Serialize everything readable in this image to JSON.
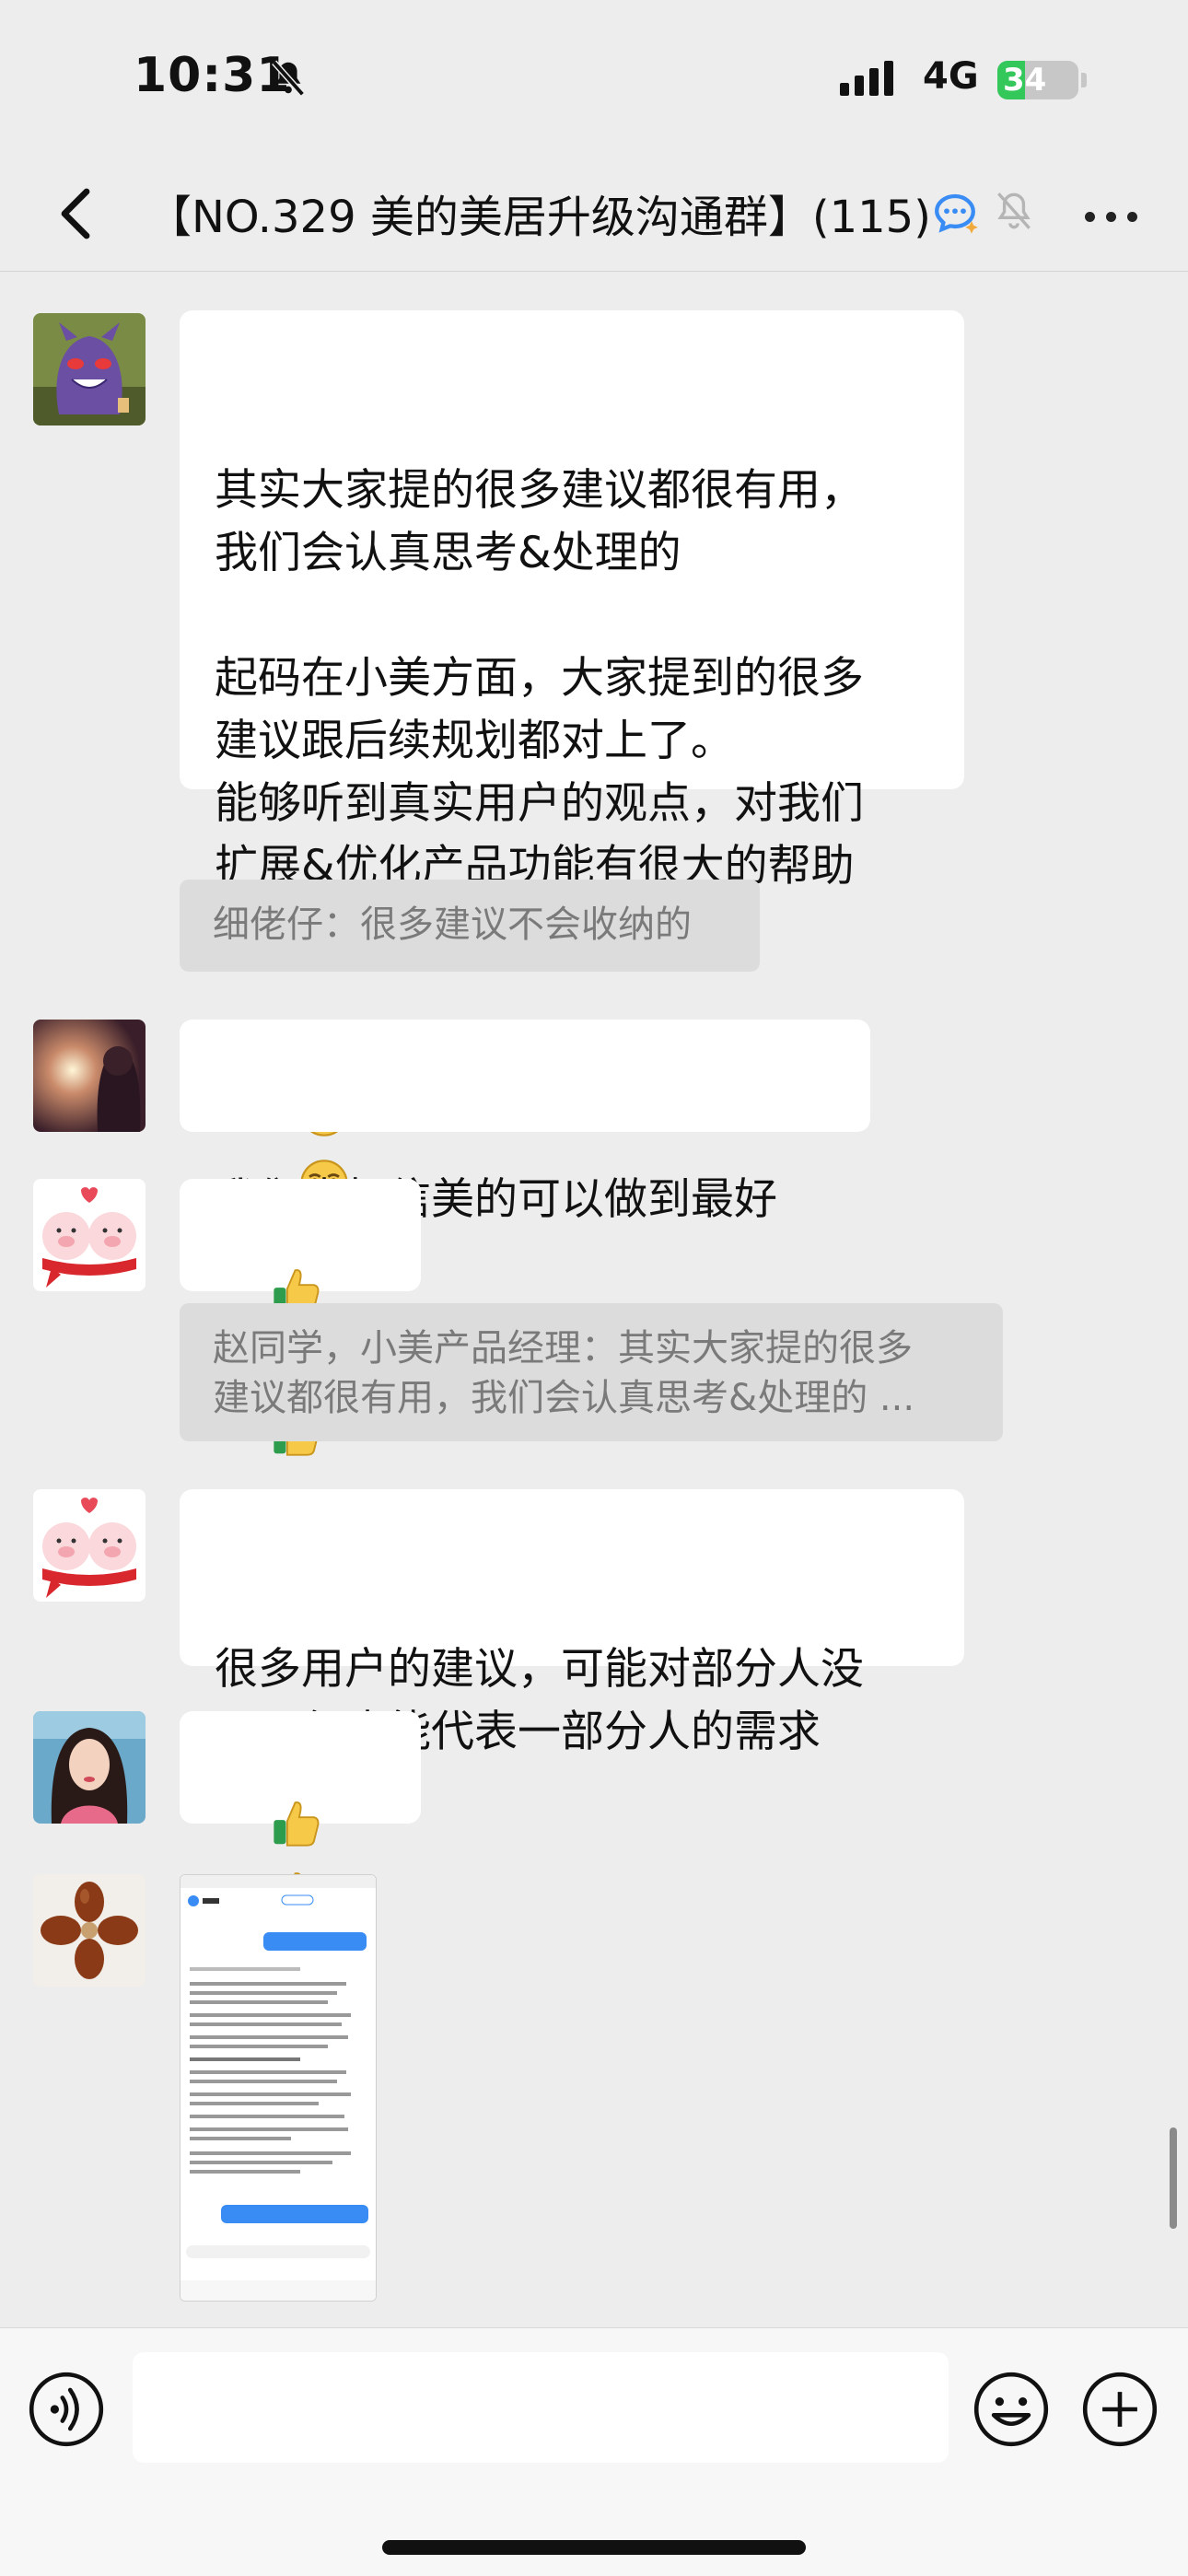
{
  "status_bar": {
    "time": "10:31",
    "network": "4G",
    "battery": "34",
    "battery_level": 0.34
  },
  "header": {
    "title": "【NO.329 美的美居升级沟通群】(115)"
  },
  "messages": [
    {
      "avatar": "purple-ghost-avatar",
      "text": "其实大家提的很多建议都很有用，\n我们会认真思考&处理的\n\n起码在小美方面，大家提到的很多\n建议跟后续规划都对上了。\n能够听到真实用户的观点，对我们\n扩展&优化产品功能有很大的帮助",
      "emojis": [
        "smirk",
        "smirk",
        "smirk"
      ],
      "quote": "细佬仔：很多建议不会收纳的"
    },
    {
      "avatar": "sunset-portrait-avatar",
      "text": "我们也相信美的可以做到最好"
    },
    {
      "avatar": "cartoon-pigs-avatar",
      "emojis": [
        "thumbs-up",
        "thumbs-up",
        "thumbs-up"
      ],
      "quote_line1": "赵同学，小美产品经理：其实大家提的很多",
      "quote_line2": "建议都很有用，我们会认真思考&处理的  ..."
    },
    {
      "avatar": "cartoon-pigs-avatar",
      "text": "很多用户的建议，可能对部分人没\n用，但也能代表一部分人的需求"
    },
    {
      "avatar": "woman-portrait-avatar",
      "emojis": [
        "thumbs-up",
        "thumbs-up",
        "thumbs-up"
      ]
    },
    {
      "avatar": "wooden-flower-avatar",
      "image": "chat-screenshot-thumbnail"
    }
  ],
  "colors": {
    "background": "#ededed",
    "bubble": "#ffffff",
    "quote": "#dcdcdc",
    "battery_green": "#34c759"
  }
}
